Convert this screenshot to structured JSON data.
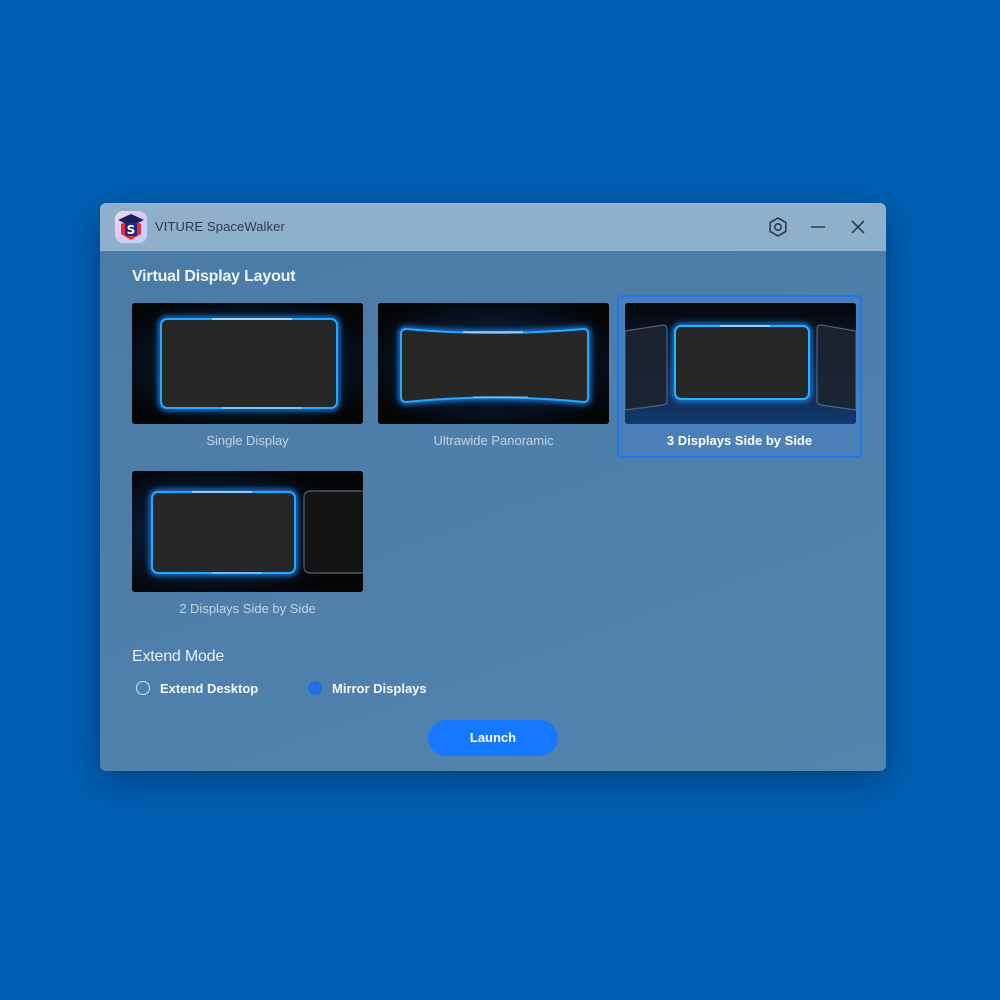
{
  "app": {
    "title": "VITURE SpaceWalker"
  },
  "titlebar": {
    "icons": [
      "settings-gear-icon",
      "minimize-icon",
      "close-icon"
    ]
  },
  "layout_section": {
    "title": "Virtual Display Layout",
    "options": [
      {
        "label": "Single Display",
        "selected": false
      },
      {
        "label": "Ultrawide Panoramic",
        "selected": false
      },
      {
        "label": "3 Displays Side by Side",
        "selected": true
      },
      {
        "label": "2 Displays Side by Side",
        "selected": false
      }
    ]
  },
  "extend_section": {
    "title": "Extend Mode",
    "options": [
      {
        "label": "Extend Desktop",
        "selected": false
      },
      {
        "label": "Mirror Displays",
        "selected": true
      }
    ]
  },
  "launch_button": {
    "label": "Launch"
  },
  "colors": {
    "desktop": "#0061b3",
    "accent": "#1677ff",
    "titlebar": "#8fb0cb",
    "window": "#4f80ab"
  }
}
